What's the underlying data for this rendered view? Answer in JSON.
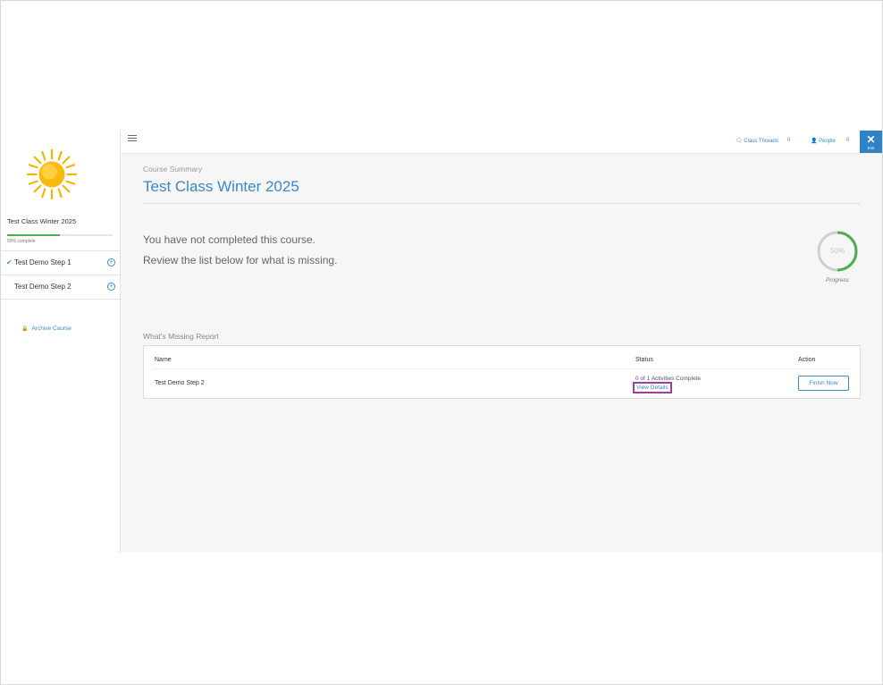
{
  "sidebar": {
    "course_name": "Test Class Winter 2025",
    "progress_fraction": 0.5,
    "progress_text": "50% complete",
    "steps": [
      {
        "label": "Test Demo Step 1",
        "completed": true
      },
      {
        "label": "Test Demo Step 2",
        "completed": false
      }
    ],
    "archive_label": "Archive Course"
  },
  "topbar": {
    "class_threads_label": "Class Threads",
    "class_threads_count": "0",
    "people_label": "People",
    "people_count": "0",
    "exit_label": "Exit"
  },
  "main": {
    "summary_label": "Course Summary",
    "title": "Test Class Winter 2025",
    "message_line1": "You have not completed this course.",
    "message_line2": "Review the list below for what is missing.",
    "progress": {
      "value_text": "50%",
      "fraction": 0.5,
      "caption": "Progress"
    },
    "report": {
      "title": "What's Missing Report",
      "headers": {
        "name": "Name",
        "status": "Status",
        "action": "Action"
      },
      "rows": [
        {
          "name": "Test Demo Step 2",
          "status": "0 of 1 Activities Complete",
          "details_link": "View Details",
          "action_label": "Finish Now"
        }
      ]
    }
  },
  "colors": {
    "accent": "#3a88c5",
    "success": "#4caf50",
    "highlight": "#a13d9b",
    "exit_bg": "#2f82c4"
  }
}
